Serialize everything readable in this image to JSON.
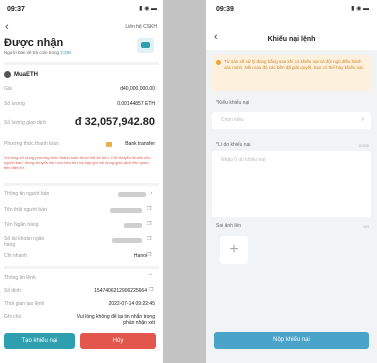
{
  "left": {
    "status_time": "09:37",
    "contact_link": "Liên hệ CSKH",
    "title": "Được nhận",
    "subtitle_prefix": "Người bán sẽ trả coin trong",
    "subtitle_highlight": "2:29s",
    "asset": "MuaETH",
    "rows": [
      {
        "label": "Giá",
        "value": "đ40,000,000.00"
      },
      {
        "label": "Số lượng",
        "value": "0.00144857 ETH"
      },
      {
        "label": "Số lượng giao dịch",
        "value": "đ 32,057,942.80"
      },
      {
        "label": "Phương thức thanh toán",
        "value": "Bank transfer"
      }
    ],
    "warning": "Vui lòng sử dụng phương thức thanh toán được liệt kê trên. Chỉ chuyển khoản cho người bán, đừng chuyển tiền cho bên thứ ba hay ghi nội dung giao dịch liên quan tiền điện tử.",
    "seller_rows": [
      {
        "label": "Thông tin người bán",
        "value": ""
      },
      {
        "label": "Tên thật người bán",
        "value": ""
      },
      {
        "label": "Tên Ngân hàng",
        "value": ""
      },
      {
        "label": "Số tài khoản ngân hàng",
        "value": ""
      },
      {
        "label": "Chi nhánh",
        "value": "Hanoi"
      }
    ],
    "order_section": "Thông tin lệnh",
    "order_rows": [
      {
        "label": "Số lệnh",
        "value": "1547406212906225664"
      },
      {
        "label": "Thời gian tạo lệnh",
        "value": "2022-07-14 09:22:45"
      },
      {
        "label": "Ghi chú",
        "value": "Vui lòng không để lại tin nhắn trong phần nhận xét"
      }
    ],
    "btn_complaint": "Tạo khiếu nại",
    "btn_cancel": "Hủy"
  },
  "right": {
    "status_time": "09:39",
    "title": "Khiếu nại lệnh",
    "notice": "Từ sàn sẽ xử lý đúng bằng sau khi có khiếu nại và đội ngũ điều hành xác minh. Nếu sau đó các bên đã giải quyết, bạn có thể hủy khiếu nại.",
    "type_label": "*Kiểu khiếu nại",
    "type_placeholder": "Chọn kiểu",
    "reason_label": "*Lí do khiếu nại",
    "reason_counter": "0/200",
    "reason_placeholder": "Nhập lí do khiếu nại",
    "image_label": "Sai ảnh lên",
    "image_counter": "0/3",
    "submit": "Nộp khiếu nại"
  },
  "colors": {
    "accent_teal": "#2f9fb0",
    "cancel_red": "#e2564c",
    "submit_blue": "#4aa3c8",
    "price_blue": "#2f6fd6",
    "warning_red": "#e05a4e"
  }
}
